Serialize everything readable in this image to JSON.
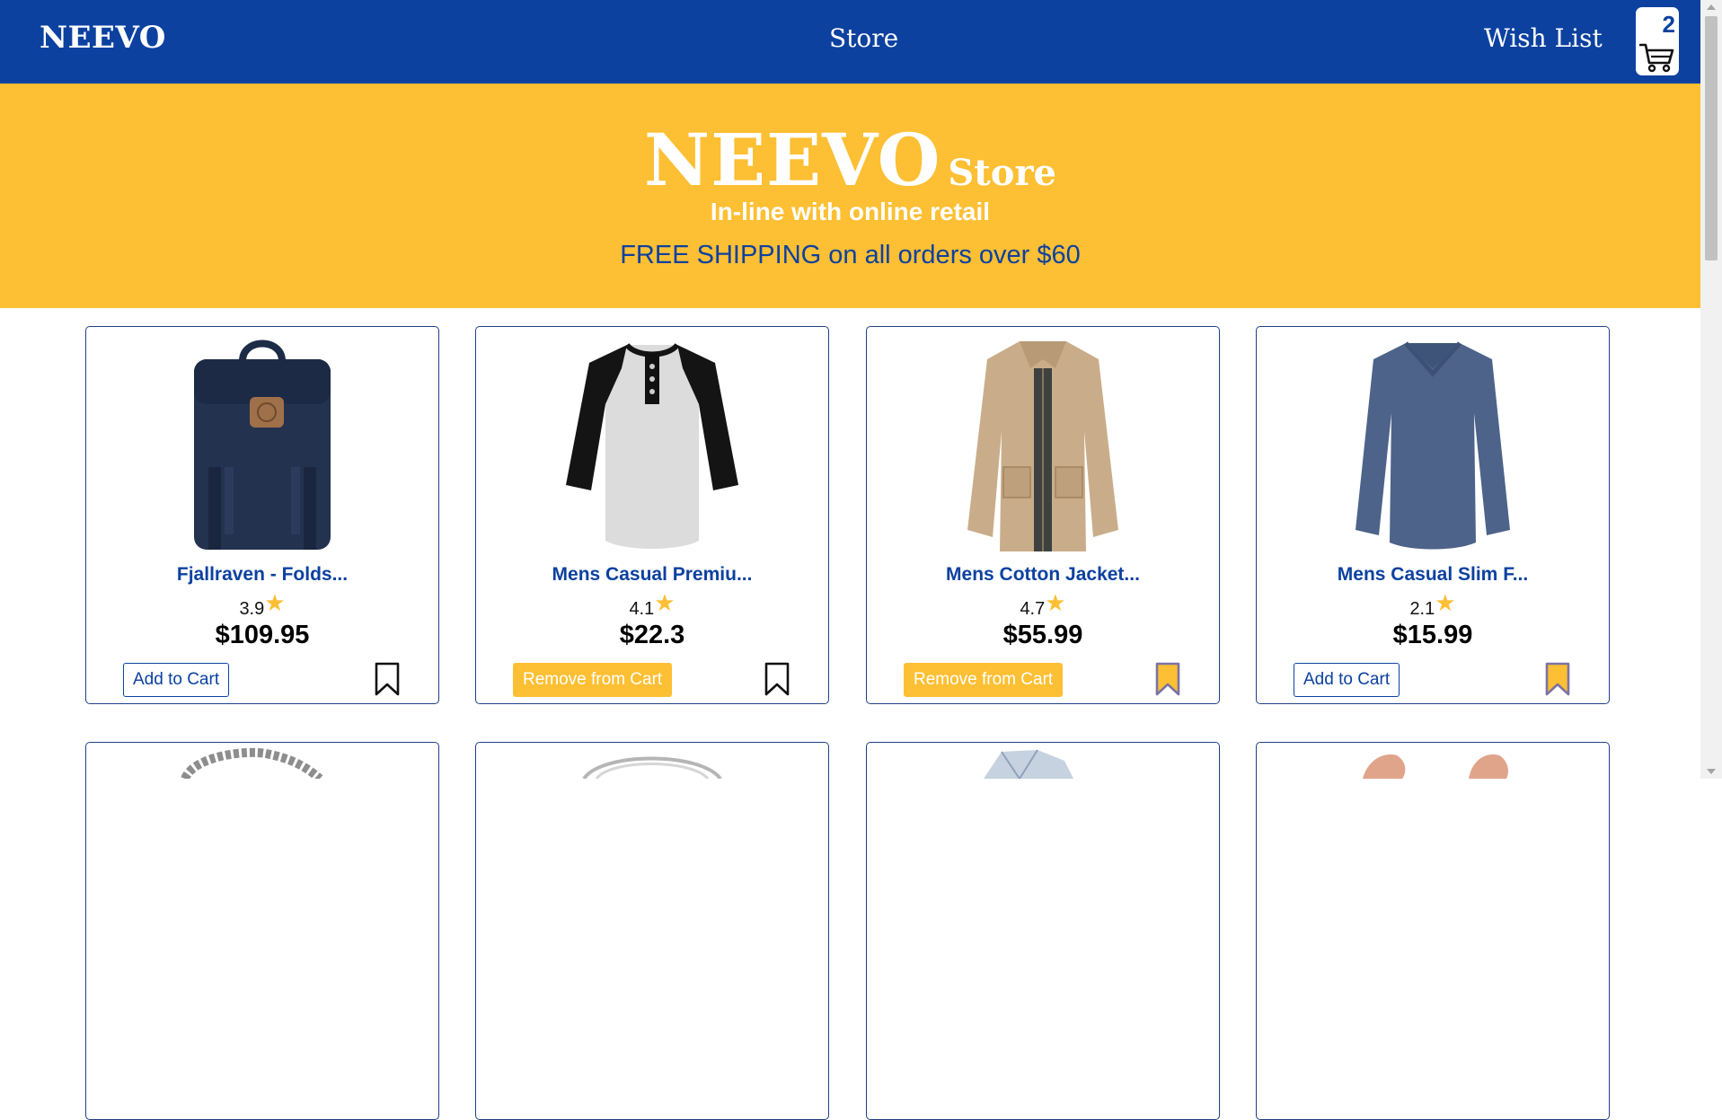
{
  "navbar": {
    "brand": "NEEVO",
    "store_link": "Store",
    "wishlist_link": "Wish List",
    "cart_count": "2"
  },
  "hero": {
    "title_big": "NEEVO",
    "title_small": "Store",
    "subtitle": "In-line with online retail",
    "shipping": "FREE SHIPPING on all orders over $60"
  },
  "products": [
    {
      "title": "Fjallraven - Folds...",
      "rating": "3.9",
      "price": "$109.95",
      "button": "Add to Cart",
      "in_cart": false,
      "wishlisted": false,
      "image": "backpack"
    },
    {
      "title": "Mens Casual Premiu...",
      "rating": "4.1",
      "price": "$22.3",
      "button": "Remove from Cart",
      "in_cart": true,
      "wishlisted": false,
      "image": "raglan-tshirt"
    },
    {
      "title": "Mens Cotton Jacket...",
      "rating": "4.7",
      "price": "$55.99",
      "button": "Remove from Cart",
      "in_cart": true,
      "wishlisted": true,
      "image": "cotton-jacket"
    },
    {
      "title": "Mens Casual Slim F...",
      "rating": "2.1",
      "price": "$15.99",
      "button": "Add to Cart",
      "in_cart": false,
      "wishlisted": true,
      "image": "long-sleeve-shirt"
    }
  ],
  "second_row_images": [
    "bracelet",
    "silver-plate",
    "diamond-ring",
    "rose-gold-earrings"
  ],
  "colors": {
    "primary_blue": "#0c41a0",
    "accent_yellow": "#fdbf33",
    "bookmark_filled": "#fdbf33",
    "bookmark_outline": "#7b73a6"
  },
  "icons": {
    "star": "star-icon",
    "bookmark": "bookmark-icon",
    "cart": "cart-icon"
  }
}
